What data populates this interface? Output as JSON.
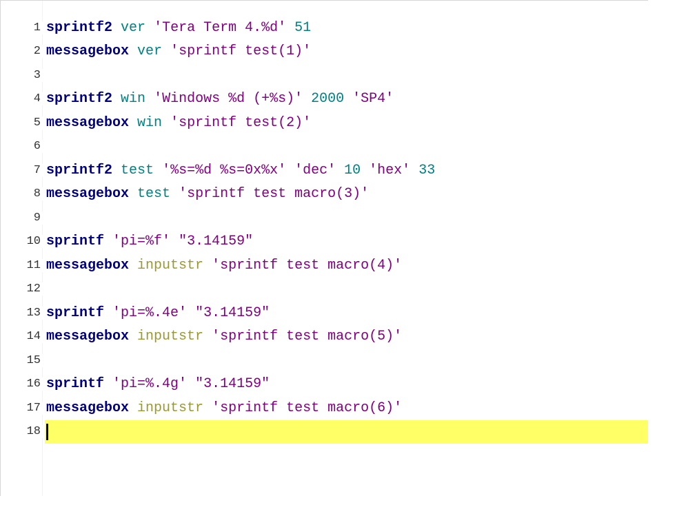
{
  "colors": {
    "keyword": "#000080",
    "variable": "#008080",
    "string": "#800080",
    "number": "#008080",
    "system_var": "#999933",
    "current_line": "#ffff66"
  },
  "lines": [
    {
      "num": "1",
      "tokens": [
        {
          "t": "kw",
          "v": "sprintf2"
        },
        {
          "t": "sp",
          "v": " "
        },
        {
          "t": "var",
          "v": "ver"
        },
        {
          "t": "sp",
          "v": " "
        },
        {
          "t": "str",
          "v": "'Tera Term 4.%d'"
        },
        {
          "t": "sp",
          "v": " "
        },
        {
          "t": "num",
          "v": "51"
        }
      ]
    },
    {
      "num": "2",
      "tokens": [
        {
          "t": "kw",
          "v": "messagebox"
        },
        {
          "t": "sp",
          "v": " "
        },
        {
          "t": "var",
          "v": "ver"
        },
        {
          "t": "sp",
          "v": " "
        },
        {
          "t": "str",
          "v": "'sprintf test(1)'"
        }
      ]
    },
    {
      "num": "3",
      "tokens": []
    },
    {
      "num": "4",
      "tokens": [
        {
          "t": "kw",
          "v": "sprintf2"
        },
        {
          "t": "sp",
          "v": " "
        },
        {
          "t": "var",
          "v": "win"
        },
        {
          "t": "sp",
          "v": " "
        },
        {
          "t": "str",
          "v": "'Windows %d (+%s)'"
        },
        {
          "t": "sp",
          "v": " "
        },
        {
          "t": "num",
          "v": "2000"
        },
        {
          "t": "sp",
          "v": " "
        },
        {
          "t": "str",
          "v": "'SP4'"
        }
      ]
    },
    {
      "num": "5",
      "tokens": [
        {
          "t": "kw",
          "v": "messagebox"
        },
        {
          "t": "sp",
          "v": " "
        },
        {
          "t": "var",
          "v": "win"
        },
        {
          "t": "sp",
          "v": " "
        },
        {
          "t": "str",
          "v": "'sprintf test(2)'"
        }
      ]
    },
    {
      "num": "6",
      "tokens": []
    },
    {
      "num": "7",
      "tokens": [
        {
          "t": "kw",
          "v": "sprintf2"
        },
        {
          "t": "sp",
          "v": " "
        },
        {
          "t": "var",
          "v": "test"
        },
        {
          "t": "sp",
          "v": " "
        },
        {
          "t": "str",
          "v": "'%s=%d %s=0x%x'"
        },
        {
          "t": "sp",
          "v": " "
        },
        {
          "t": "str",
          "v": "'dec'"
        },
        {
          "t": "sp",
          "v": " "
        },
        {
          "t": "num",
          "v": "10"
        },
        {
          "t": "sp",
          "v": " "
        },
        {
          "t": "str",
          "v": "'hex'"
        },
        {
          "t": "sp",
          "v": " "
        },
        {
          "t": "num",
          "v": "33"
        }
      ]
    },
    {
      "num": "8",
      "tokens": [
        {
          "t": "kw",
          "v": "messagebox"
        },
        {
          "t": "sp",
          "v": " "
        },
        {
          "t": "var",
          "v": "test"
        },
        {
          "t": "sp",
          "v": " "
        },
        {
          "t": "str",
          "v": "'sprintf test macro(3)'"
        }
      ]
    },
    {
      "num": "9",
      "tokens": []
    },
    {
      "num": "10",
      "tokens": [
        {
          "t": "kw",
          "v": "sprintf"
        },
        {
          "t": "sp",
          "v": " "
        },
        {
          "t": "str",
          "v": "'pi=%f'"
        },
        {
          "t": "sp",
          "v": " "
        },
        {
          "t": "dq",
          "v": "\"3.14159\""
        }
      ]
    },
    {
      "num": "11",
      "tokens": [
        {
          "t": "kw",
          "v": "messagebox"
        },
        {
          "t": "sp",
          "v": " "
        },
        {
          "t": "sys",
          "v": "inputstr"
        },
        {
          "t": "sp",
          "v": " "
        },
        {
          "t": "str",
          "v": "'sprintf test macro(4)'"
        }
      ]
    },
    {
      "num": "12",
      "tokens": []
    },
    {
      "num": "13",
      "tokens": [
        {
          "t": "kw",
          "v": "sprintf"
        },
        {
          "t": "sp",
          "v": " "
        },
        {
          "t": "str",
          "v": "'pi=%.4e'"
        },
        {
          "t": "sp",
          "v": " "
        },
        {
          "t": "dq",
          "v": "\"3.14159\""
        }
      ]
    },
    {
      "num": "14",
      "tokens": [
        {
          "t": "kw",
          "v": "messagebox"
        },
        {
          "t": "sp",
          "v": " "
        },
        {
          "t": "sys",
          "v": "inputstr"
        },
        {
          "t": "sp",
          "v": " "
        },
        {
          "t": "str",
          "v": "'sprintf test macro(5)'"
        }
      ]
    },
    {
      "num": "15",
      "tokens": []
    },
    {
      "num": "16",
      "tokens": [
        {
          "t": "kw",
          "v": "sprintf"
        },
        {
          "t": "sp",
          "v": " "
        },
        {
          "t": "str",
          "v": "'pi=%.4g'"
        },
        {
          "t": "sp",
          "v": " "
        },
        {
          "t": "dq",
          "v": "\"3.14159\""
        }
      ]
    },
    {
      "num": "17",
      "tokens": [
        {
          "t": "kw",
          "v": "messagebox"
        },
        {
          "t": "sp",
          "v": " "
        },
        {
          "t": "sys",
          "v": "inputstr"
        },
        {
          "t": "sp",
          "v": " "
        },
        {
          "t": "str",
          "v": "'sprintf test macro(6)'"
        }
      ]
    },
    {
      "num": "18",
      "tokens": [],
      "current": true
    }
  ]
}
